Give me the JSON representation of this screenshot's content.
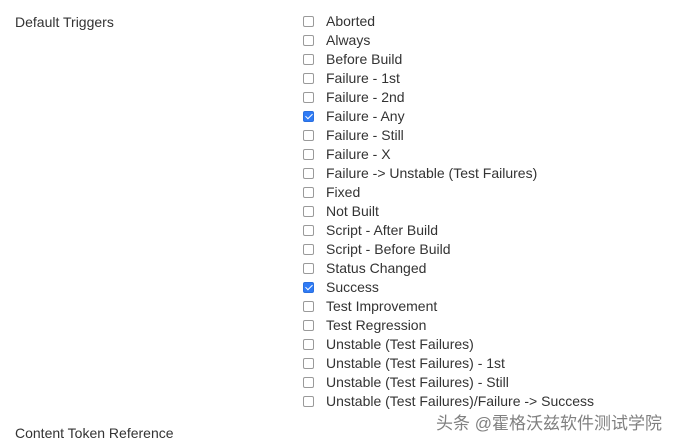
{
  "section": {
    "default_triggers_label": "Default Triggers",
    "content_token_label": "Content Token Reference"
  },
  "triggers": [
    {
      "label": "Aborted",
      "checked": false
    },
    {
      "label": "Always",
      "checked": false
    },
    {
      "label": "Before Build",
      "checked": false
    },
    {
      "label": "Failure - 1st",
      "checked": false
    },
    {
      "label": "Failure - 2nd",
      "checked": false
    },
    {
      "label": "Failure - Any",
      "checked": true
    },
    {
      "label": "Failure - Still",
      "checked": false
    },
    {
      "label": "Failure - X",
      "checked": false
    },
    {
      "label": "Failure -> Unstable (Test Failures)",
      "checked": false
    },
    {
      "label": "Fixed",
      "checked": false
    },
    {
      "label": "Not Built",
      "checked": false
    },
    {
      "label": "Script - After Build",
      "checked": false
    },
    {
      "label": "Script - Before Build",
      "checked": false
    },
    {
      "label": "Status Changed",
      "checked": false
    },
    {
      "label": "Success",
      "checked": true
    },
    {
      "label": "Test Improvement",
      "checked": false
    },
    {
      "label": "Test Regression",
      "checked": false
    },
    {
      "label": "Unstable (Test Failures)",
      "checked": false
    },
    {
      "label": "Unstable (Test Failures) - 1st",
      "checked": false
    },
    {
      "label": "Unstable (Test Failures) - Still",
      "checked": false
    },
    {
      "label": "Unstable (Test Failures)/Failure -> Success",
      "checked": false
    }
  ],
  "watermark": {
    "text": "头条 @霍格沃兹软件测试学院"
  },
  "colors": {
    "checkbox_checked": "#2f7bf5",
    "text": "#333333"
  }
}
